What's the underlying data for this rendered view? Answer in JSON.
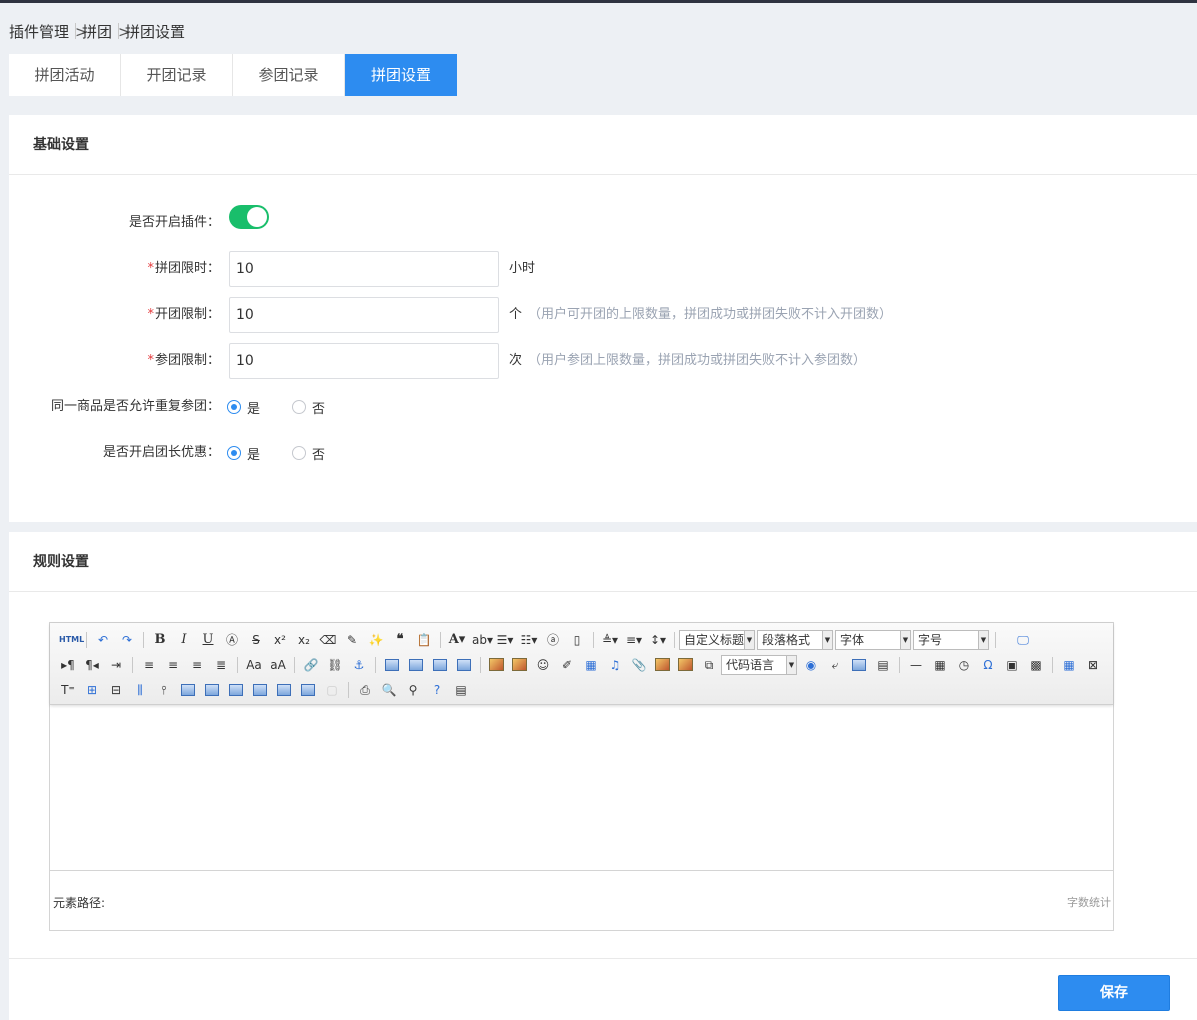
{
  "breadcrumb": {
    "items": [
      "插件管理",
      "拼团",
      "拼团设置"
    ],
    "separator": ">"
  },
  "tabs": [
    {
      "label": "拼团活动"
    },
    {
      "label": "开团记录"
    },
    {
      "label": "参团记录"
    },
    {
      "label": "拼团设置",
      "active": true
    }
  ],
  "basic": {
    "title": "基础设置",
    "enable_plugin": {
      "label": "是否开启插件：",
      "on": true
    },
    "time_limit": {
      "required": "*",
      "label": "拼团限时：",
      "value": "10",
      "unit": "小时"
    },
    "open_limit": {
      "required": "*",
      "label": "开团限制：",
      "value": "10",
      "unit": "个",
      "hint": "（用户可开团的上限数量，拼团成功或拼团失败不计入开团数）"
    },
    "join_limit": {
      "required": "*",
      "label": "参团限制：",
      "value": "10",
      "unit": "次",
      "hint": "（用户参团上限数量，拼团成功或拼团失败不计入参团数）"
    },
    "repeat_join": {
      "label": "同一商品是否允许重复参团：",
      "yes": "是",
      "no": "否",
      "selected": "yes"
    },
    "leader_discount": {
      "label": "是否开启团长优惠：",
      "yes": "是",
      "no": "否",
      "selected": "yes"
    }
  },
  "rules": {
    "title": "规则设置",
    "editor": {
      "html_label": "HTML",
      "custom_title": "自定义标题",
      "paragraph": "段落格式",
      "font": "字体",
      "size": "字号",
      "code_lang": "代码语言",
      "path_label": "元素路径:",
      "word_count": "字数统计"
    }
  },
  "actions": {
    "save": "保存"
  },
  "colors": {
    "primary": "#2d8cf0",
    "switch_on": "#19be6b",
    "required": "#e4393c",
    "hint": "#9aa3b2"
  }
}
